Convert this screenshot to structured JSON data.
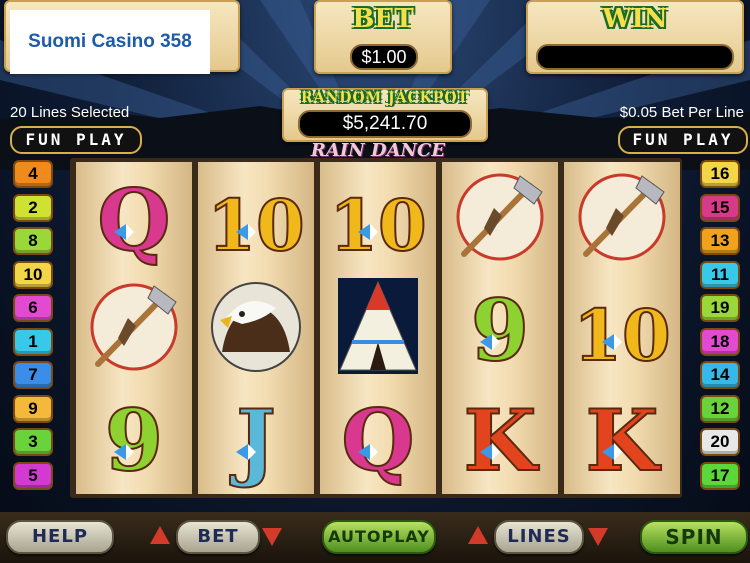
{
  "site_badge": "Suomi Casino 358",
  "header": {
    "bet_label": "BET",
    "bet_value": "$1.00",
    "win_label": "WIN",
    "win_value": "",
    "jackpot_label": "RANDOM JACKPOT",
    "jackpot_value": "$5,241.70",
    "game_title": "RAIN DANCE",
    "lines_selected": "20 Lines Selected",
    "bet_per_line": "$0.05 Bet Per Line",
    "fun_play_left": "FUN PLAY",
    "fun_play_right": "FUN PLAY"
  },
  "left_lines": [
    {
      "n": "4",
      "color": "#f08a1c"
    },
    {
      "n": "2",
      "color": "#cfe234"
    },
    {
      "n": "8",
      "color": "#9ad83a"
    },
    {
      "n": "10",
      "color": "#f2d548"
    },
    {
      "n": "6",
      "color": "#e24ad2"
    },
    {
      "n": "1",
      "color": "#38c8ea"
    },
    {
      "n": "7",
      "color": "#3a8ee8"
    },
    {
      "n": "9",
      "color": "#f4b83a"
    },
    {
      "n": "3",
      "color": "#6ad23a"
    },
    {
      "n": "5",
      "color": "#d23ad2"
    }
  ],
  "right_lines": [
    {
      "n": "16",
      "color": "#f2d548"
    },
    {
      "n": "15",
      "color": "#d83a8a"
    },
    {
      "n": "13",
      "color": "#f0a21c"
    },
    {
      "n": "11",
      "color": "#38c8ea"
    },
    {
      "n": "19",
      "color": "#9ad83a"
    },
    {
      "n": "18",
      "color": "#e24ad2"
    },
    {
      "n": "14",
      "color": "#38b8e8"
    },
    {
      "n": "12",
      "color": "#6ad23a"
    },
    {
      "n": "20",
      "color": "#e8e8e8"
    },
    {
      "n": "17",
      "color": "#5ad83a"
    }
  ],
  "reels": [
    [
      "Q",
      "tomahawk",
      "9"
    ],
    [
      "10",
      "eagle",
      "J"
    ],
    [
      "10",
      "teepee",
      "Q"
    ],
    [
      "tomahawk",
      "9",
      "K"
    ],
    [
      "tomahawk",
      "10",
      "K"
    ]
  ],
  "symbol_colors": {
    "Q": "#d8388e",
    "10": "#f0b81a",
    "9": "#8ed232",
    "J": "#5ab8d8",
    "K": "#e2441e"
  },
  "controls": {
    "help": "HELP",
    "bet": "BET",
    "autoplay": "AUTOPLAY",
    "lines": "LINES",
    "spin": "SPIN"
  }
}
